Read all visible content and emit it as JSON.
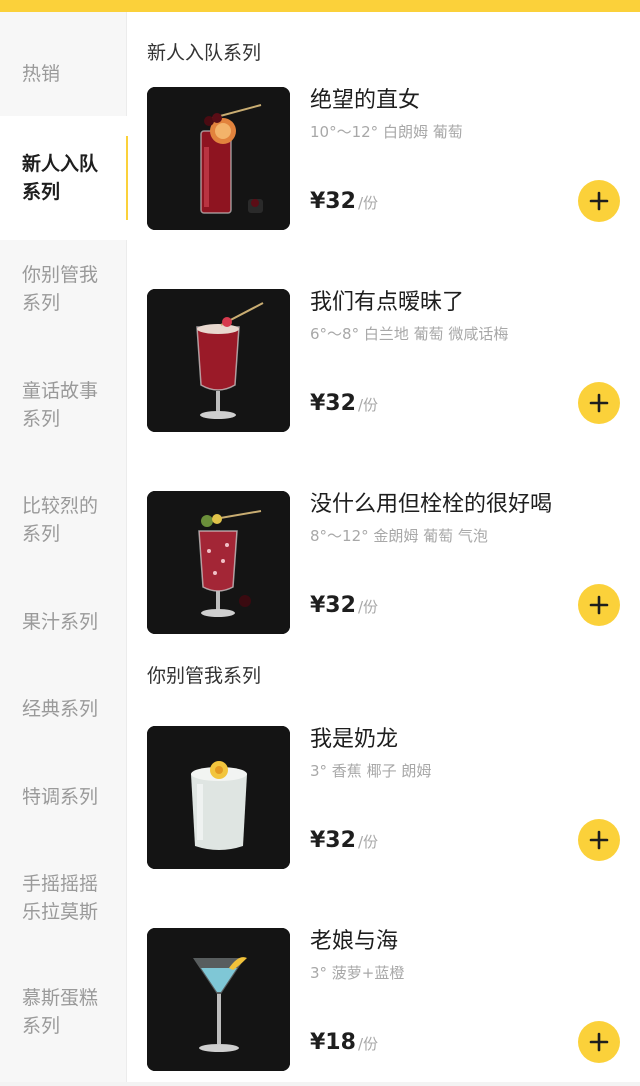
{
  "theme": {
    "accent": "#fbd13a",
    "thumb_bg": "#141414"
  },
  "sidebar": {
    "items": [
      {
        "label": "热销",
        "active": false
      },
      {
        "label": "新人入队\n系列",
        "active": true
      },
      {
        "label": "你别管我\n系列",
        "active": false
      },
      {
        "label": "童话故事\n系列",
        "active": false
      },
      {
        "label": "比较烈的\n系列",
        "active": false
      },
      {
        "label": "果汁系列",
        "active": false
      },
      {
        "label": "经典系列",
        "active": false
      },
      {
        "label": "特调系列",
        "active": false
      },
      {
        "label": "手摇摇摇\n乐拉莫斯",
        "active": false
      },
      {
        "label": "慕斯蛋糕\n系列",
        "active": false
      }
    ]
  },
  "sections": [
    {
      "title": "新人入队系列",
      "products": [
        {
          "name": "绝望的直女",
          "desc": "10°～12° 白朗姆 葡萄",
          "price": "¥32",
          "unit": "/份",
          "image_icon": "red-highball-cocktail-image"
        },
        {
          "name": "我们有点暧昧了",
          "desc": "6°～8° 白兰地 葡萄 微咸话梅",
          "price": "¥32",
          "unit": "/份",
          "image_icon": "red-goblet-cocktail-image"
        },
        {
          "name": "没什么用但栓栓的很好喝",
          "desc": "8°～12° 金朗姆 葡萄 气泡",
          "price": "¥32",
          "unit": "/份",
          "image_icon": "sparkling-red-cocktail-image"
        }
      ]
    },
    {
      "title": "你别管我系列",
      "products": [
        {
          "name": "我是奶龙",
          "desc": "3° 香蕉 椰子 朗姆",
          "price": "¥32",
          "unit": "/份",
          "image_icon": "milky-tumbler-cocktail-image"
        },
        {
          "name": "老娘与海",
          "desc": "3° 菠萝+蓝橙",
          "price": "¥18",
          "unit": "/份",
          "image_icon": "blue-martini-cocktail-image"
        }
      ]
    }
  ]
}
